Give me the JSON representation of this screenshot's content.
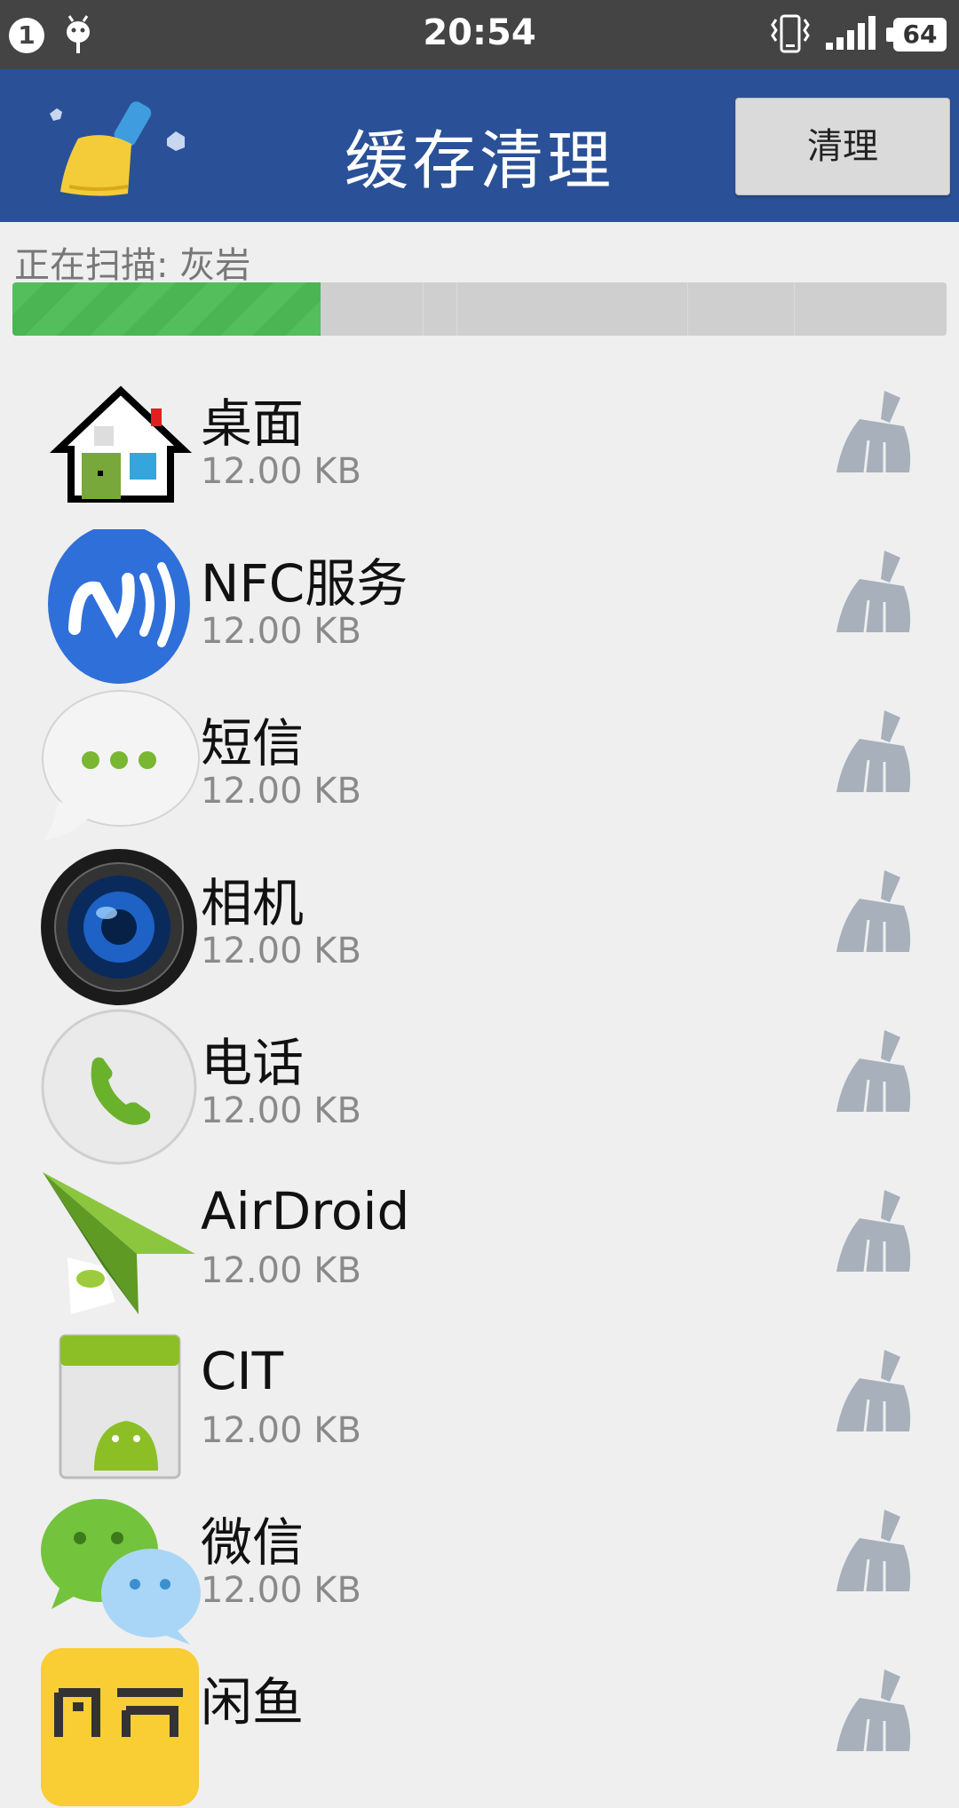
{
  "status_bar": {
    "notification_count": "1",
    "time": "20:54",
    "battery": "64"
  },
  "header": {
    "title": "缓存清理",
    "clean_button": "清理"
  },
  "scan": {
    "label": "正在扫描: 灰岩",
    "progress_percent": 33
  },
  "apps": [
    {
      "name": "桌面",
      "size": "12.00 KB",
      "icon": "home-launcher-icon"
    },
    {
      "name": "NFC服务",
      "size": "12.00 KB",
      "icon": "nfc-icon"
    },
    {
      "name": "短信",
      "size": "12.00 KB",
      "icon": "message-bubble-icon"
    },
    {
      "name": "相机",
      "size": "12.00 KB",
      "icon": "camera-lens-icon"
    },
    {
      "name": "电话",
      "size": "12.00 KB",
      "icon": "phone-icon"
    },
    {
      "name": "AirDroid",
      "size": "12.00 KB",
      "icon": "paper-plane-icon"
    },
    {
      "name": "CIT",
      "size": "12.00 KB",
      "icon": "android-cit-icon"
    },
    {
      "name": "微信",
      "size": "12.00 KB",
      "icon": "wechat-icon"
    },
    {
      "name": "闲鱼",
      "size": "",
      "icon": "xianyu-icon"
    }
  ],
  "colors": {
    "header": "#2a5197",
    "progress": "#55be5c",
    "broom": "#a7b0bb"
  }
}
